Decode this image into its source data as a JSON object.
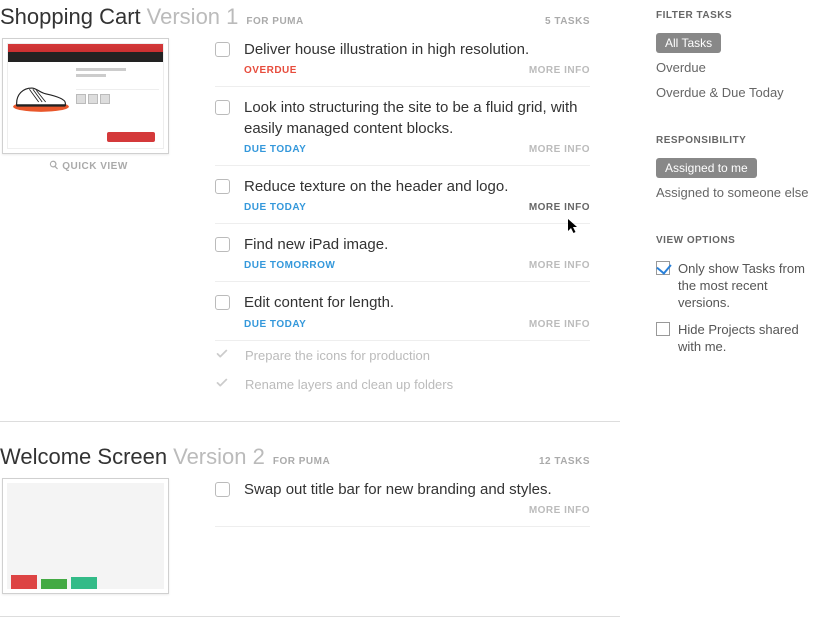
{
  "labels": {
    "more_info": "MORE INFO",
    "quick_view": "QUICK VIEW",
    "for_prefix": "FOR",
    "tasks_suffix": "TASKS"
  },
  "projects": [
    {
      "name": "Shopping Cart",
      "version": "Version 1",
      "client": "PUMA",
      "task_count": 5,
      "thumb_kind": "sneaker",
      "tasks": [
        {
          "title": "Deliver house illustration in high resolution.",
          "due_label": "OVERDUE",
          "due_class": "due-overdue",
          "more_active": false
        },
        {
          "title": "Look into structuring the site to be a fluid grid, with easily managed content blocks.",
          "due_label": "DUE TODAY",
          "due_class": "due-today",
          "more_active": false
        },
        {
          "title": "Reduce texture on the header and logo.",
          "due_label": "DUE TODAY",
          "due_class": "due-today",
          "more_active": true
        },
        {
          "title": "Find new iPad image.",
          "due_label": "DUE TOMORROW",
          "due_class": "due-tomorrow",
          "more_active": false
        },
        {
          "title": "Edit content for length.",
          "due_label": "DUE TODAY",
          "due_class": "due-today",
          "more_active": false
        }
      ],
      "done": [
        {
          "title": "Prepare the icons for production"
        },
        {
          "title": "Rename layers and clean up folders"
        }
      ]
    },
    {
      "name": "Welcome Screen",
      "version": "Version 2",
      "client": "PUMA",
      "task_count": 12,
      "thumb_kind": "bars",
      "tasks": [
        {
          "title": "Swap out title bar for new branding and styles.",
          "due_label": "",
          "due_class": "",
          "more_active": false
        }
      ],
      "done": []
    }
  ],
  "sidebar": {
    "filter_tasks": {
      "heading": "FILTER TASKS",
      "items": [
        {
          "label": "All Tasks",
          "selected": true
        },
        {
          "label": "Overdue",
          "selected": false
        },
        {
          "label": "Overdue & Due Today",
          "selected": false
        }
      ]
    },
    "responsibility": {
      "heading": "RESPONSIBILITY",
      "items": [
        {
          "label": "Assigned to me",
          "selected": true
        },
        {
          "label": "Assigned to someone else",
          "selected": false
        }
      ]
    },
    "view_options": {
      "heading": "VIEW OPTIONS",
      "items": [
        {
          "label": "Only show Tasks from the most recent versions.",
          "checked": true
        },
        {
          "label": "Hide Projects shared with me.",
          "checked": false
        }
      ]
    }
  }
}
